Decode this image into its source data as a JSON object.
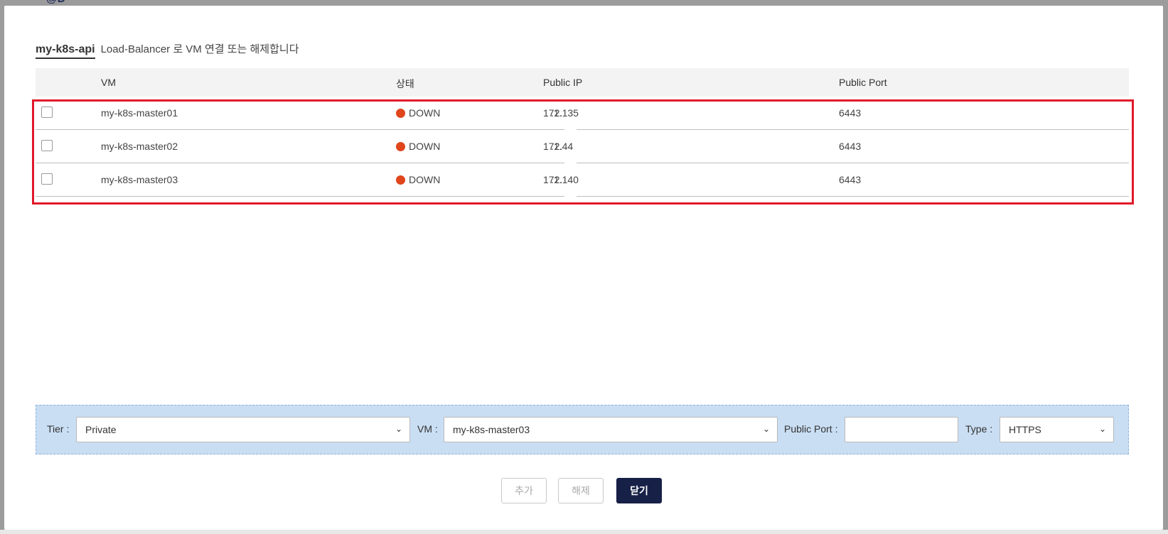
{
  "background": {
    "top_fragment": "@D"
  },
  "dialog": {
    "lb_name": "my-k8s-api",
    "description": "Load-Balancer 로 VM 연결 또는 해제합니다"
  },
  "table": {
    "headers": {
      "vm": "VM",
      "status": "상태",
      "public_ip": "Public IP",
      "public_port": "Public Port"
    },
    "rows": [
      {
        "vm": "my-k8s-master01",
        "status": "DOWN",
        "ip_prefix": "172.",
        "ip_suffix": ".1.135",
        "port": "6443"
      },
      {
        "vm": "my-k8s-master02",
        "status": "DOWN",
        "ip_prefix": "172.",
        "ip_suffix": ".1.44",
        "port": "6443"
      },
      {
        "vm": "my-k8s-master03",
        "status": "DOWN",
        "ip_prefix": "172.",
        "ip_suffix": ".1.140",
        "port": "6443"
      }
    ],
    "status_color": "#e0451c",
    "highlight_color": "#e0192a"
  },
  "form": {
    "tier_label": "Tier :",
    "tier_value": "Private",
    "vm_label": "VM :",
    "vm_value": "my-k8s-master03",
    "port_label": "Public Port :",
    "port_value": "",
    "type_label": "Type :",
    "type_value": "HTTPS"
  },
  "buttons": {
    "add": "추가",
    "remove": "해제",
    "close": "닫기"
  },
  "colors": {
    "form_bg": "#c9def3",
    "close_button": "#172046"
  }
}
